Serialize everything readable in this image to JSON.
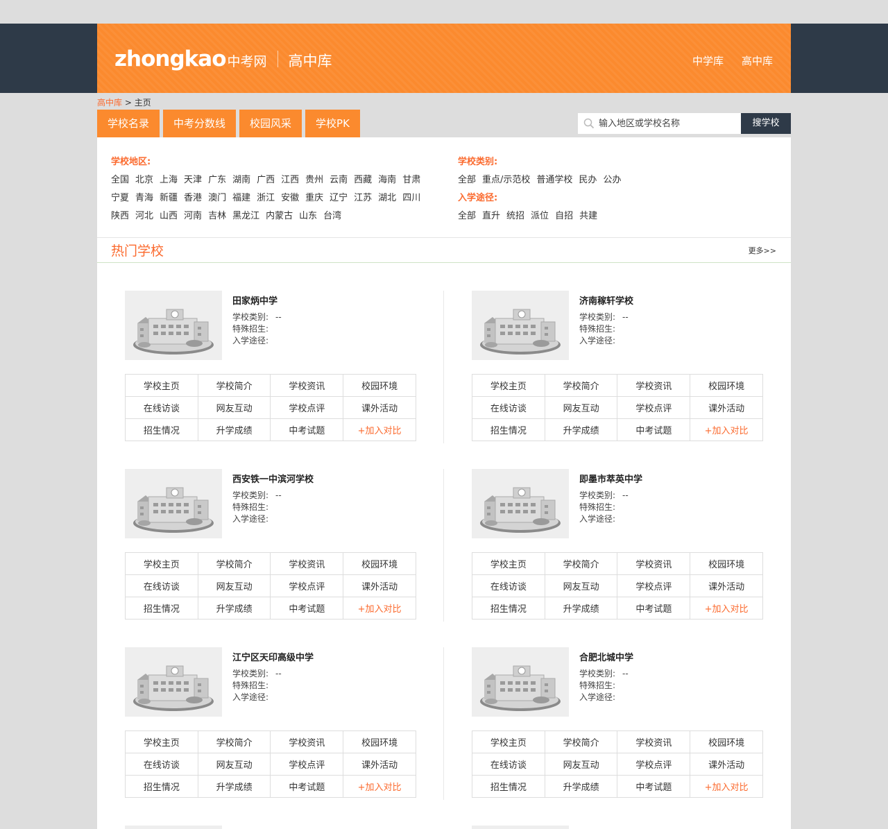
{
  "header": {
    "logo_en": "zhongkao",
    "logo_cn": "中考网",
    "logo_sub": "高中库",
    "nav": [
      "中学库",
      "高中库"
    ]
  },
  "breadcrumb": {
    "home": "高中库",
    "sep": " > ",
    "current": "主页"
  },
  "tabs": [
    "学校名录",
    "中考分数线",
    "校园风采",
    "学校PK"
  ],
  "search": {
    "placeholder": "输入地区或学校名称",
    "button": "搜学校"
  },
  "filters": {
    "region_label": "学校地区:",
    "region_rows": [
      [
        "全国",
        "北京",
        "上海",
        "天津",
        "广东",
        "湖南",
        "广西",
        "江西",
        "贵州",
        "云南",
        "西藏",
        "海南",
        "甘肃"
      ],
      [
        "宁夏",
        "青海",
        "新疆",
        "香港",
        "澳门",
        "福建",
        "浙江",
        "安徽",
        "重庆",
        "辽宁",
        "江苏",
        "湖北",
        "四川"
      ],
      [
        "陕西",
        "河北",
        "山西",
        "河南",
        "吉林",
        "黑龙江",
        "内蒙古",
        "山东",
        "台湾"
      ]
    ],
    "type_label": "学校类别:",
    "types": [
      "全部",
      "重点/示范校",
      "普通学校",
      "民办",
      "公办"
    ],
    "path_label": "入学途径:",
    "paths": [
      "全部",
      "直升",
      "统招",
      "派位",
      "自招",
      "共建"
    ]
  },
  "hot": {
    "title": "热门学校",
    "more": "更多>>"
  },
  "card_labels": {
    "type": "学校类别:",
    "type_value": "--",
    "special": "特殊招生:",
    "path": "入学途径:",
    "links": [
      [
        "学校主页",
        "学校简介",
        "学校资讯",
        "校园环境"
      ],
      [
        "在线访谈",
        "网友互动",
        "学校点评",
        "课外活动"
      ],
      [
        "招生情况",
        "升学成绩",
        "中考试题",
        "+加入对比"
      ]
    ]
  },
  "schools": [
    "田家炳中学",
    "济南稼轩学校",
    "西安铁一中滨河学校",
    "即墨市萃英中学",
    "江宁区天印高级中学",
    "合肥北城中学"
  ],
  "colors": {
    "accent": "#fb8a2e",
    "dark": "#2e3a48",
    "highlight": "#fb6a2e"
  }
}
